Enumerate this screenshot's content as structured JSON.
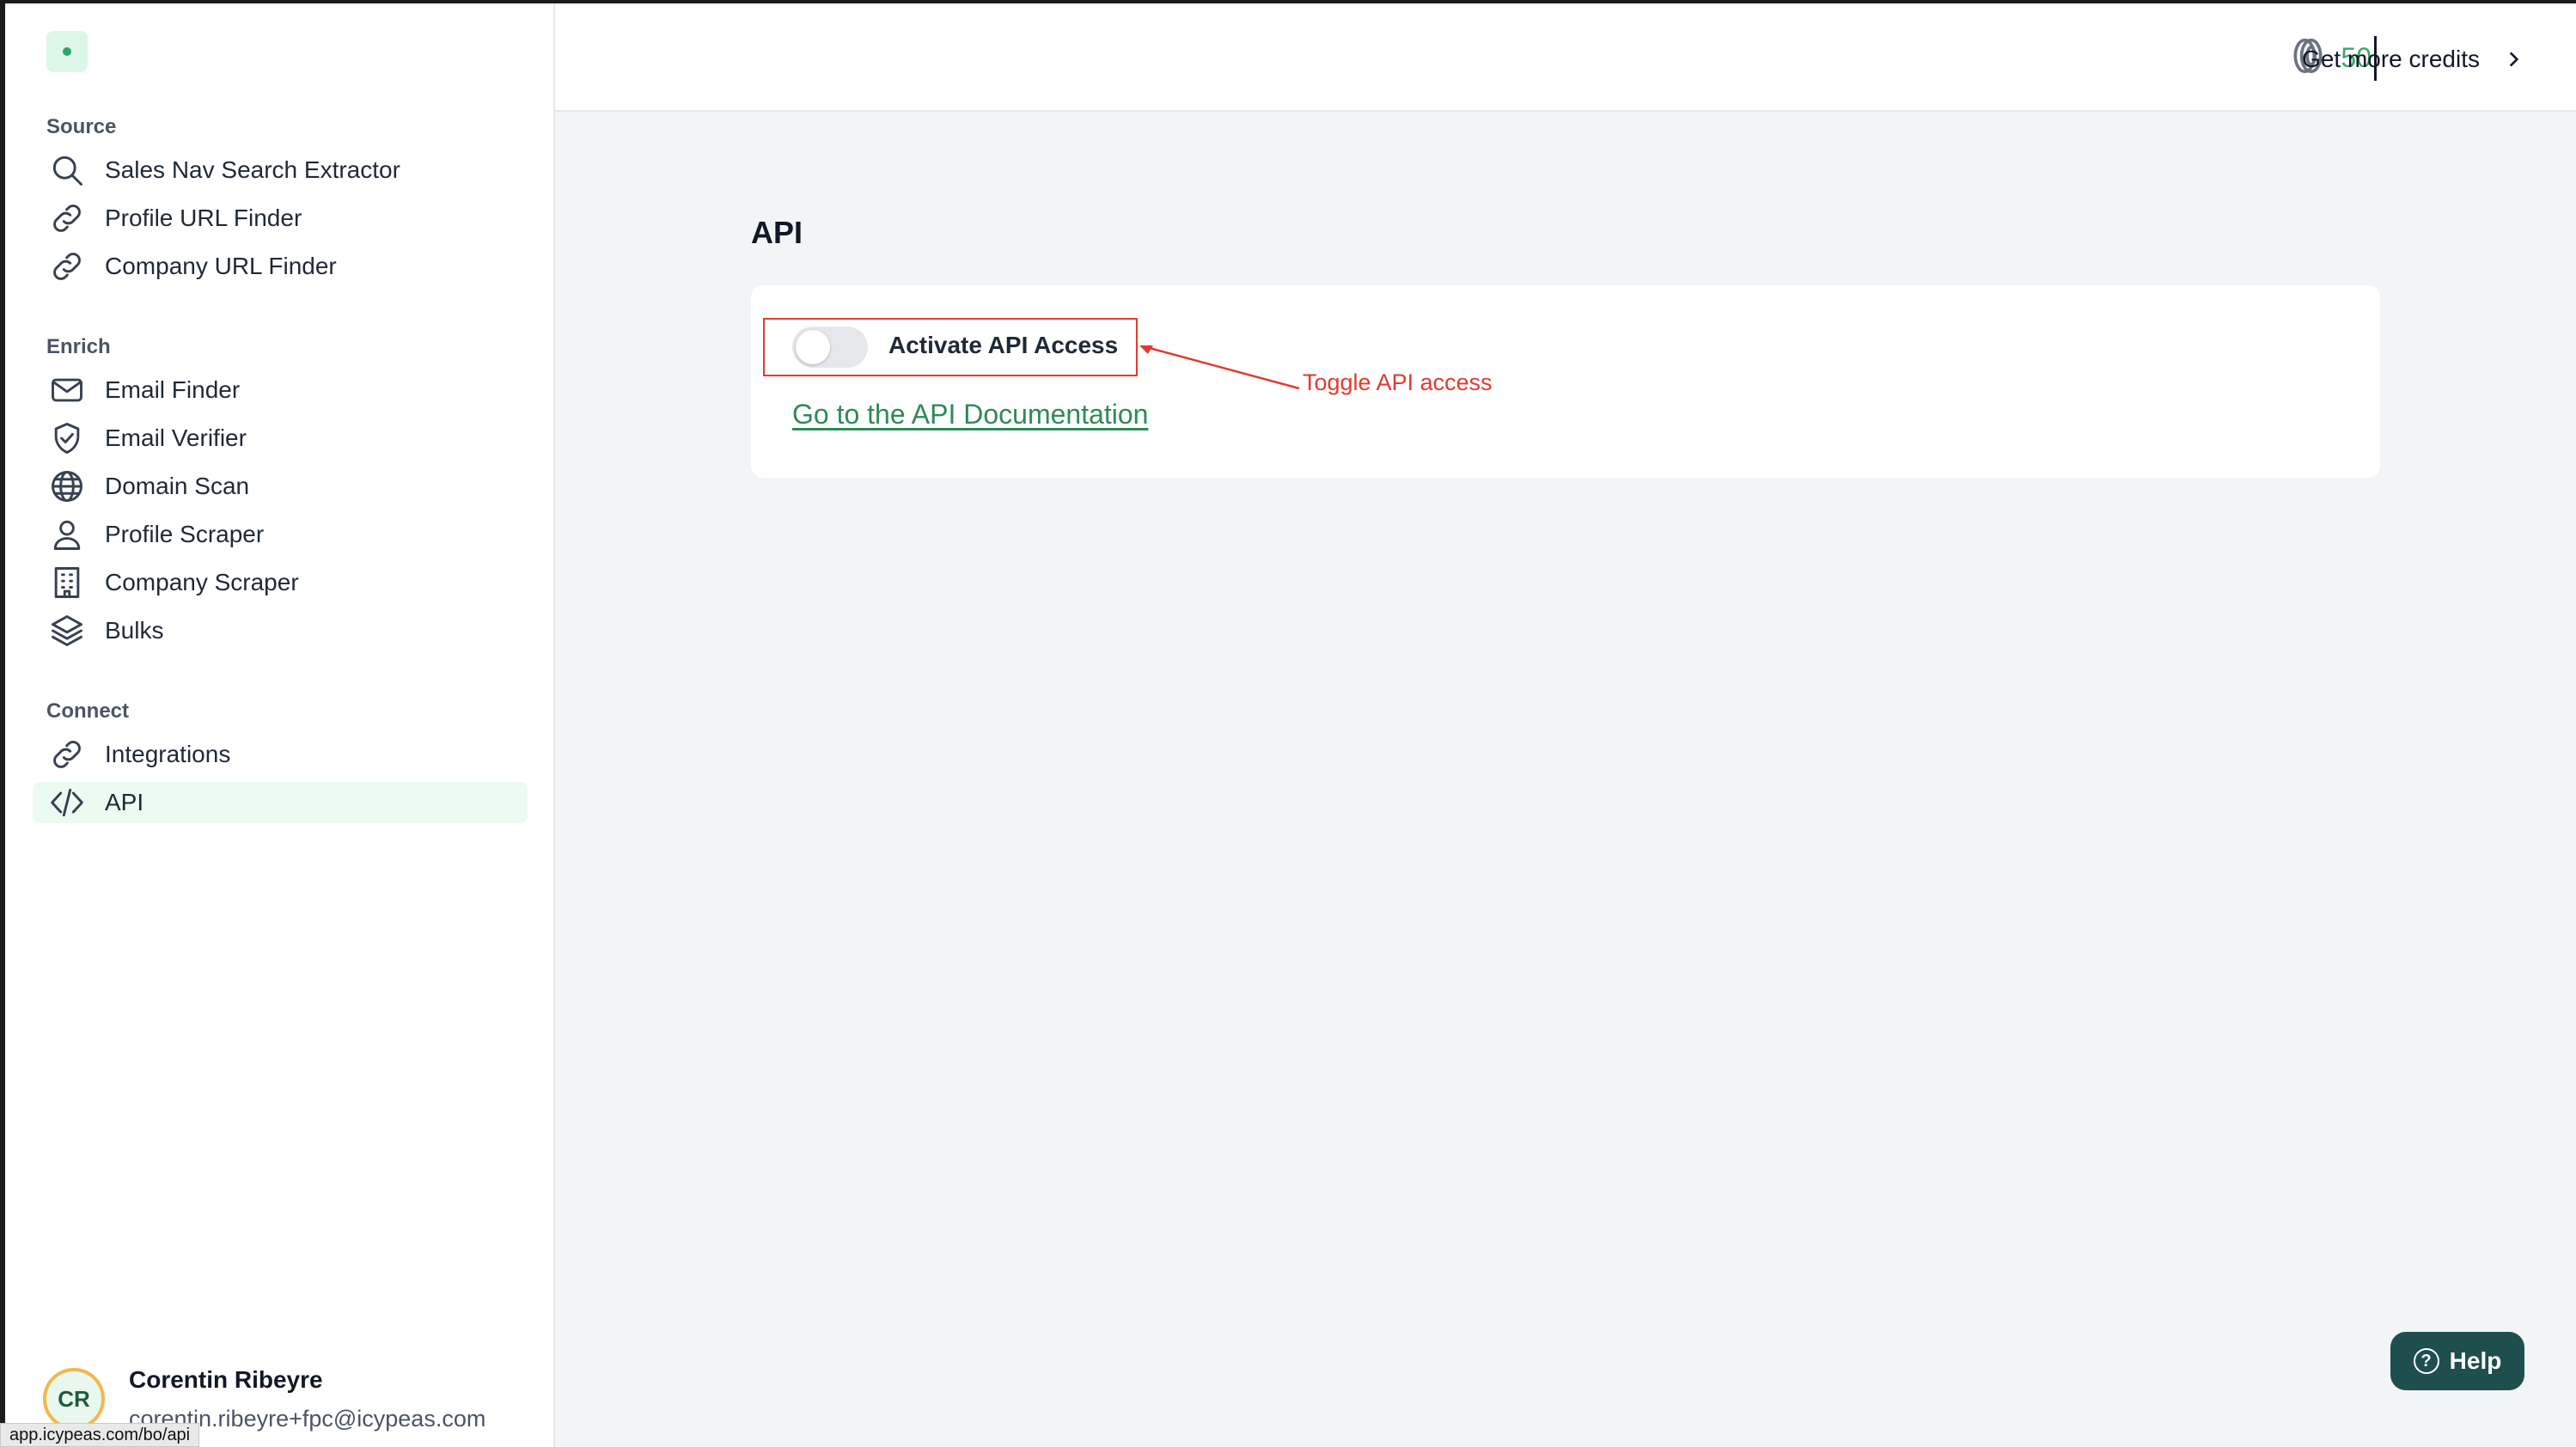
{
  "sidebar": {
    "sections": {
      "source": "Source",
      "enrich": "Enrich",
      "connect": "Connect"
    },
    "items": [
      {
        "label": "Sales Nav Search Extractor",
        "icon": "search-icon"
      },
      {
        "label": "Profile URL Finder",
        "icon": "link-icon"
      },
      {
        "label": "Company URL Finder",
        "icon": "link-icon"
      },
      {
        "label": "Email Finder",
        "icon": "mail-icon"
      },
      {
        "label": "Email Verifier",
        "icon": "shield-check-icon"
      },
      {
        "label": "Domain Scan",
        "icon": "globe-icon"
      },
      {
        "label": "Profile Scraper",
        "icon": "user-icon"
      },
      {
        "label": "Company Scraper",
        "icon": "building-icon"
      },
      {
        "label": "Bulks",
        "icon": "layers-icon"
      },
      {
        "label": "Integrations",
        "icon": "link-icon"
      },
      {
        "label": "API",
        "icon": "code-icon",
        "active": true
      }
    ],
    "user": {
      "initials": "CR",
      "name": "Corentin Ribeyre",
      "email": "corentin.ribeyre+fpc@icypeas.com"
    }
  },
  "status_bar": {
    "url": "app.icypeas.com/bo/api"
  },
  "topbar": {
    "credits": "50",
    "get_credits_label": "Get more credits"
  },
  "main": {
    "title": "API",
    "toggle": {
      "label": "Activate API Access",
      "checked": false
    },
    "doc_link": "Go to the API Documentation",
    "annotation": "Toggle API access"
  },
  "help": {
    "label": "Help"
  },
  "colors": {
    "accent": "#3aa76d",
    "link": "#2e8a57",
    "annotation": "#e23b2e",
    "help_bg": "#1f4e4f"
  }
}
